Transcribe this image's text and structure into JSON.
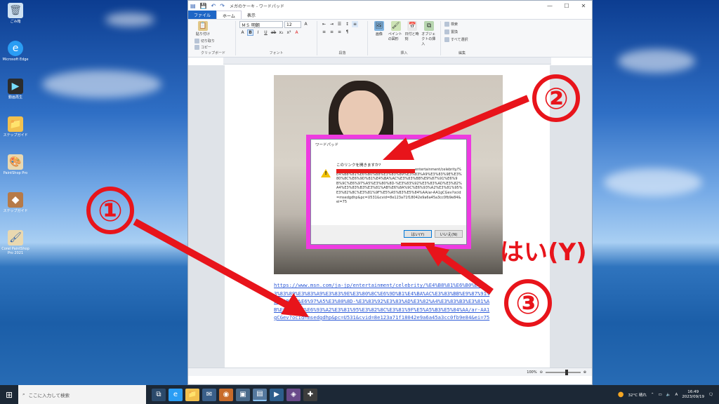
{
  "desktop": {
    "icons": [
      {
        "label": "ごみ箱",
        "icon": "recycle-bin-icon"
      },
      {
        "label": "Microsoft Edge",
        "icon": "edge-icon"
      },
      {
        "label": "動画再生",
        "icon": "video-icon"
      },
      {
        "label": "ステップガイド",
        "icon": "folder-icon"
      },
      {
        "label": "PaintShop Pro",
        "icon": "paintshop-icon"
      },
      {
        "label": "ステップガイド",
        "icon": "guide-icon"
      },
      {
        "label": "Corel PaintShop Pro 2021",
        "icon": "corel-icon"
      }
    ]
  },
  "window": {
    "title": "メガのケーキ - ワードパッド",
    "tabs": {
      "file": "ファイル",
      "home": "ホーム",
      "view": "表示"
    },
    "ribbon": {
      "clipboard": {
        "paste": "貼り付け",
        "cut": "切り取り",
        "copy": "コピー",
        "label": "クリップボード"
      },
      "font": {
        "name": "ＭＳ 明朝",
        "size": "12",
        "label": "フォント"
      },
      "paragraph": {
        "label": "段落"
      },
      "insert": {
        "picture": "画像",
        "paint": "ペイントの図形",
        "datetime": "日付と時刻",
        "object": "オブジェクトの挿入",
        "label": "挿入"
      },
      "edit": {
        "find": "検索",
        "replace": "置換",
        "selectall": "すべて選択",
        "label": "編集"
      }
    },
    "document": {
      "link": "https://www.msn.com/ja-jp/entertainment/celebrity/%E4%B8%81%E6%B0%B8%E3%83%89%E3%83%A9%E3%83%9E%E3%80%8C%E6%9D%B1%E4%BA%AC%E3%83%BB%E9%87%91%E6%9B%9C%E6%97%A5%E3%80%8D-%E3%83%92%E3%83%AD%E3%82%A4%E3%83%B3%E3%81%AB%E6%8A%9C%E6%93%A2%E3%81%95%E3%82%8C%E3%81%9F%E5%A5%B3%E5%84%AA/ar-AA1gCGev?ocid=msedgdhp&pc=U531&cvid=8e123a71f18042e9a6a45a3cc0fb9e84&ei=75"
    },
    "status": {
      "zoom": "100%"
    }
  },
  "dialog": {
    "title": "ワードパッド",
    "question": "このリンクを開きますか?",
    "url": "entertainment/celebrity/%E4%B8%81%E6%B0%B8%E3%83%89%E3%83%A9%E3%83%9E%E3%80%8C%E6%9D%B1%E4%BA%AC%E3%83%BB%E9%87%91%E6%9B%9C%E6%97%A5%E3%80%8D-%E3%83%92%E3%83%AD%E3%82%A4%E3%83%B3%E3%81%AB%E6%8A%9C%E6%93%A2%E3%81%95%E3%82%8C%E3%81%9F%E5%A5%B3%E5%84%AA/ar-AA1gCGev?ocid=msedgdhp&pc=U531&cvid=8e123a71f18042e9a6a45a3cc0fb9e84&ei=75",
    "yes": "はい(Y)",
    "no": "いいえ(N)"
  },
  "annotations": {
    "step1": "①",
    "step2": "②",
    "step3": "③",
    "yes_label": "はい(Y)",
    "color": "#e8141b"
  },
  "taskbar": {
    "search_placeholder": "ここに入力して検索",
    "weather": "32°C 晴れ",
    "time": "16:49",
    "date": "2023/09/19"
  }
}
